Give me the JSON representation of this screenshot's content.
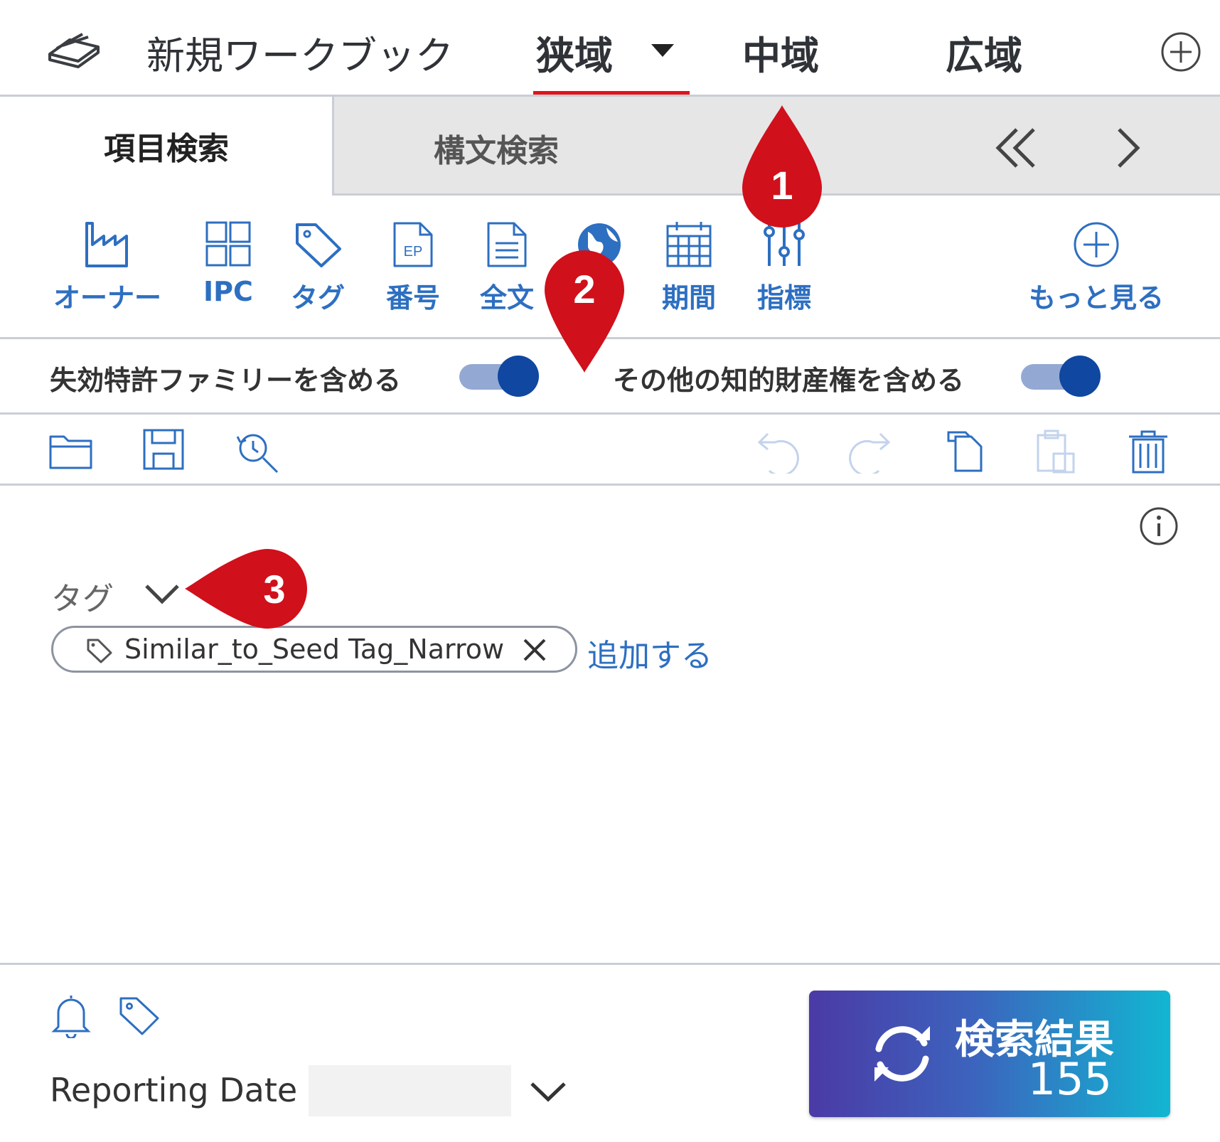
{
  "workbook": {
    "title": "新規ワークブック"
  },
  "workspace_tabs": [
    {
      "label": "狭域",
      "active": true
    },
    {
      "label": "中域"
    },
    {
      "label": "広域"
    }
  ],
  "search_tabs": [
    {
      "label": "項目検索",
      "active": true
    },
    {
      "label": "構文検索"
    }
  ],
  "fields": [
    {
      "label": "オーナー",
      "icon": "factory-icon"
    },
    {
      "label": "IPC",
      "icon": "grid-icon"
    },
    {
      "label": "タグ",
      "icon": "tag-icon"
    },
    {
      "label": "番号",
      "icon": "ep-document-icon",
      "icon_text": "EP"
    },
    {
      "label": "全文",
      "icon": "document-icon"
    },
    {
      "label": "",
      "icon": "globe-icon"
    },
    {
      "label": "期間",
      "icon": "calendar-icon"
    },
    {
      "label": "指標",
      "icon": "sliders-icon"
    }
  ],
  "more": {
    "label": "もっと見る"
  },
  "toggles": [
    {
      "label": "失効特許ファミリーを含める",
      "on": true
    },
    {
      "label": "その他の知的財産権を含める",
      "on": true
    }
  ],
  "tag_section": {
    "label": "タグ",
    "chips": [
      {
        "label": "Similar_to_Seed Tag_Narrow"
      }
    ],
    "add_label": "追加する"
  },
  "footer": {
    "reporting_date_label": "Reporting Date",
    "reporting_date_value": ""
  },
  "results_button": {
    "label": "検索結果",
    "count": "155"
  },
  "markers": [
    "1",
    "2",
    "3"
  ],
  "colors": {
    "accent_blue": "#2d6fc1",
    "active_underline": "#e0141a",
    "toggle_on": "#0f47a1",
    "marker_red": "#d0101b",
    "button_gradient_start": "#4b3aa6",
    "button_gradient_end": "#12b6d2"
  }
}
